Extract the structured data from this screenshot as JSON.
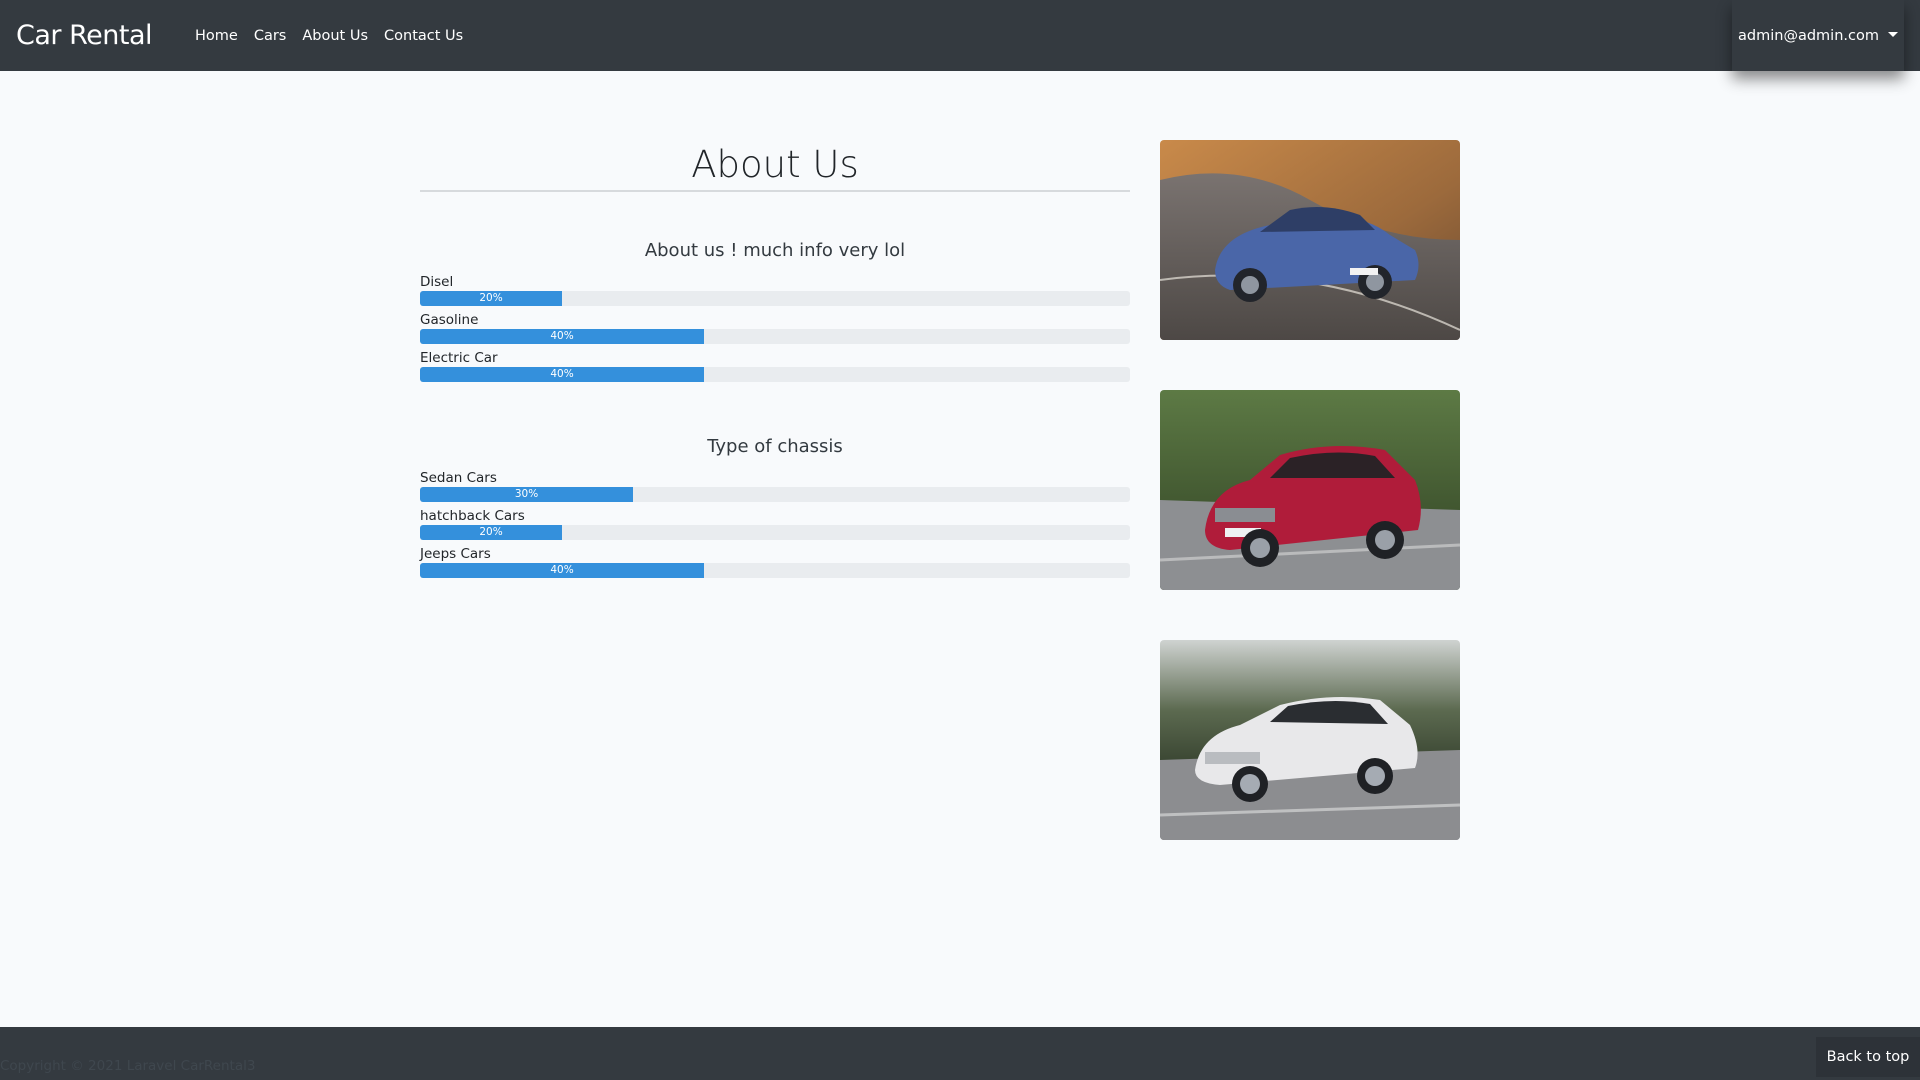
{
  "navbar": {
    "brand": "Car Rental",
    "links": [
      "Home",
      "Cars",
      "About Us",
      "Contact Us"
    ],
    "user": "admin@admin.com"
  },
  "main": {
    "title": "About Us",
    "sections": [
      {
        "heading": "About us ! much info very lol",
        "bars": [
          {
            "label": "Disel",
            "percent": 20,
            "text": "20%"
          },
          {
            "label": "Gasoline",
            "percent": 40,
            "text": "40%"
          },
          {
            "label": "Electric Car",
            "percent": 40,
            "text": "40%"
          }
        ]
      },
      {
        "heading": "Type of chassis",
        "bars": [
          {
            "label": "Sedan Cars",
            "percent": 30,
            "text": "30%"
          },
          {
            "label": "hatchback Cars",
            "percent": 20,
            "text": "20%"
          },
          {
            "label": "Jeeps Cars",
            "percent": 40,
            "text": "40%"
          }
        ]
      }
    ],
    "images": [
      {
        "name": "blue-sedan-photo",
        "body_color": "#4a66a8"
      },
      {
        "name": "red-suv-photo",
        "body_color": "#b01c3a"
      },
      {
        "name": "white-suv-photo",
        "body_color": "#e8e8ea"
      }
    ]
  },
  "footer": {
    "copyright": "Copyright © 2021 Laravel CarRental3",
    "back_to_top": "Back to top"
  },
  "colors": {
    "navbar_bg": "#343a40",
    "progress_fill": "#3490dc",
    "progress_track": "#e9ecef",
    "page_bg": "#f8fafc"
  }
}
